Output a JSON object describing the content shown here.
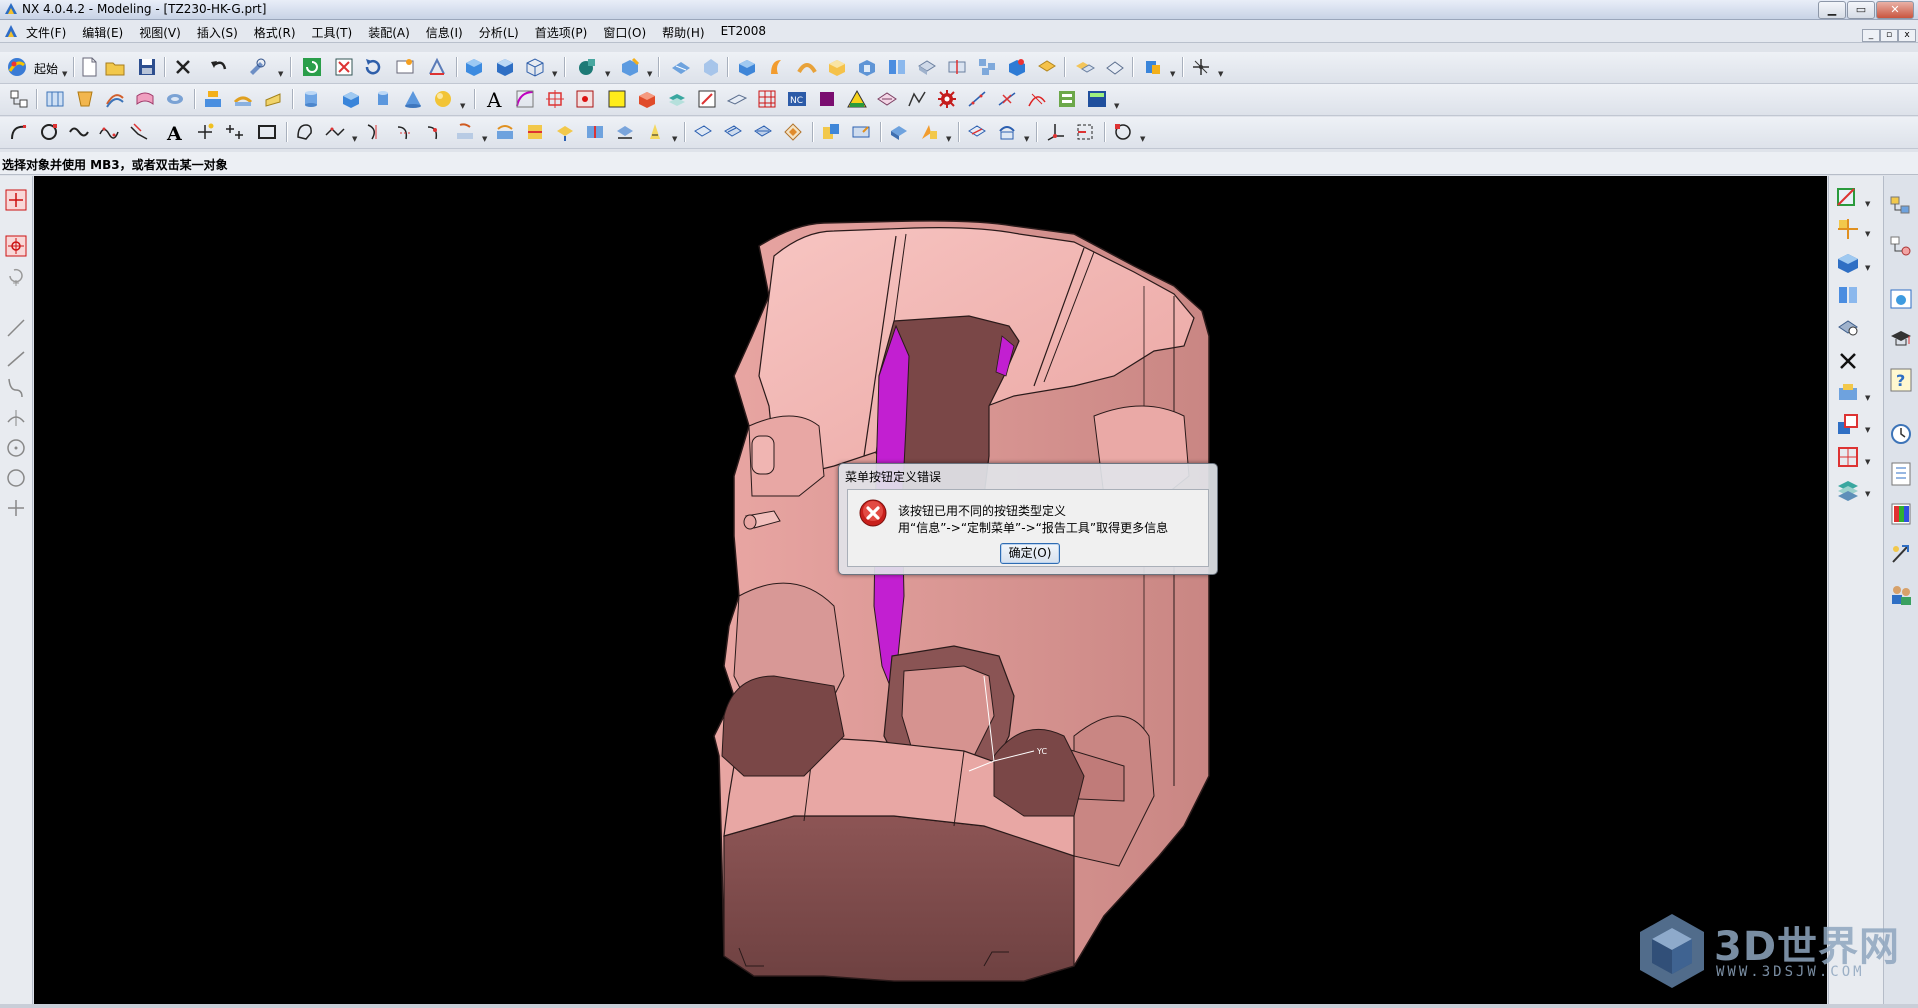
{
  "window": {
    "title": "NX 4.0.4.2 - Modeling - [TZ230-HK-G.prt]",
    "controls": {
      "minimize": "▁",
      "maximize": "▭",
      "close": "✕"
    },
    "mdi_controls": {
      "minimize": "_",
      "restore": "▫",
      "close": "x"
    }
  },
  "menubar": {
    "items": [
      {
        "label": "文件(F)"
      },
      {
        "label": "编辑(E)"
      },
      {
        "label": "视图(V)"
      },
      {
        "label": "插入(S)"
      },
      {
        "label": "格式(R)"
      },
      {
        "label": "工具(T)"
      },
      {
        "label": "装配(A)"
      },
      {
        "label": "信息(I)"
      },
      {
        "label": "分析(L)"
      },
      {
        "label": "首选项(P)"
      },
      {
        "label": "窗口(O)"
      },
      {
        "label": "帮助(H)"
      },
      {
        "label": "ET2008"
      }
    ]
  },
  "toolbar": {
    "start_label": "起始"
  },
  "statusline": {
    "prompt": "选择对象并使用 MB3，或者双击某一对象"
  },
  "viewport": {
    "axis_label": "YC"
  },
  "dialog": {
    "title": "菜单按钮定义错误",
    "message_line1": "该按钮已用不同的按钮类型定义",
    "message_line2": "用“信息”->“定制菜单”->“报告工具”取得更多信息",
    "ok_label": "确定(O)"
  },
  "watermark": {
    "title": "3D世界网",
    "url": "WWW.3DSJW.COM"
  },
  "colors": {
    "part_light": "#f2b3b0",
    "part_mid": "#d98a88",
    "part_dark": "#7a4747",
    "highlight": "#c000d0",
    "viewport_bg": "#000000"
  }
}
